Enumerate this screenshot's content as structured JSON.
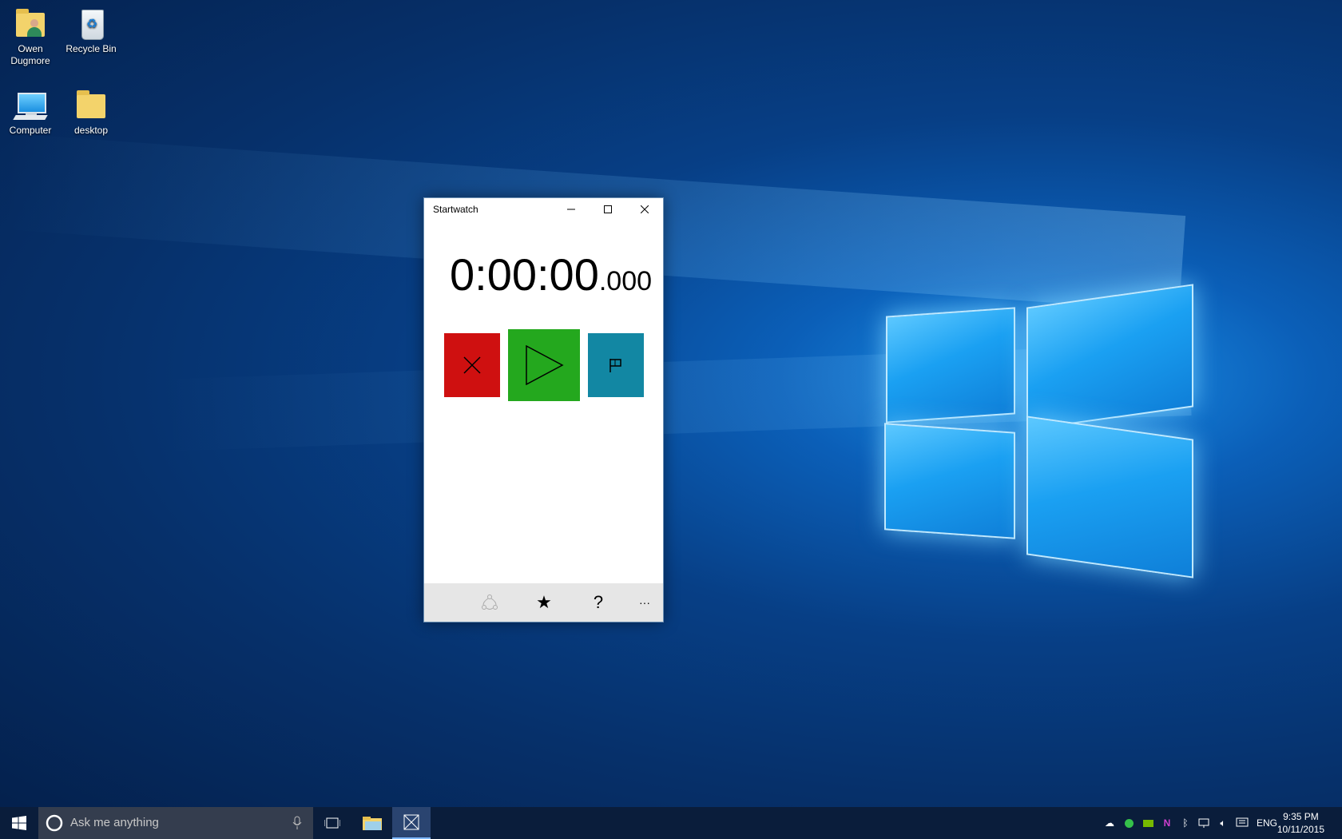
{
  "desktop": {
    "icons": [
      {
        "label": "Owen Dugmore",
        "line1": "Owen",
        "line2": "Dugmore",
        "icon": "user-folder-icon"
      },
      {
        "label": "Recycle Bin",
        "icon": "recycle-bin-icon"
      },
      {
        "label": "Computer",
        "icon": "computer-icon"
      },
      {
        "label": "desktop",
        "icon": "folder-icon"
      }
    ]
  },
  "window": {
    "title": "Startwatch",
    "controls": {
      "minimize": "minimize-icon",
      "maximize": "maximize-icon",
      "close": "close-icon"
    },
    "timer": {
      "main": "0:00:00",
      "ms": ".000"
    },
    "buttons": [
      {
        "name": "reset",
        "icon": "x-icon",
        "color": "#cf1010"
      },
      {
        "name": "start",
        "icon": "play-icon",
        "color": "#24a81e"
      },
      {
        "name": "lap",
        "icon": "flag-icon",
        "color": "#1287a3"
      }
    ],
    "appbar": [
      {
        "name": "share",
        "icon": "share-icon",
        "enabled": false
      },
      {
        "name": "favorite",
        "icon": "star-icon",
        "glyph": "★"
      },
      {
        "name": "help",
        "icon": "help-icon",
        "glyph": "?"
      },
      {
        "name": "more",
        "icon": "more-icon",
        "glyph": "···"
      }
    ]
  },
  "taskbar": {
    "search_placeholder": "Ask me anything",
    "tray": {
      "language": "ENG",
      "time": "9:35 PM",
      "date": "10/11/2015"
    }
  }
}
